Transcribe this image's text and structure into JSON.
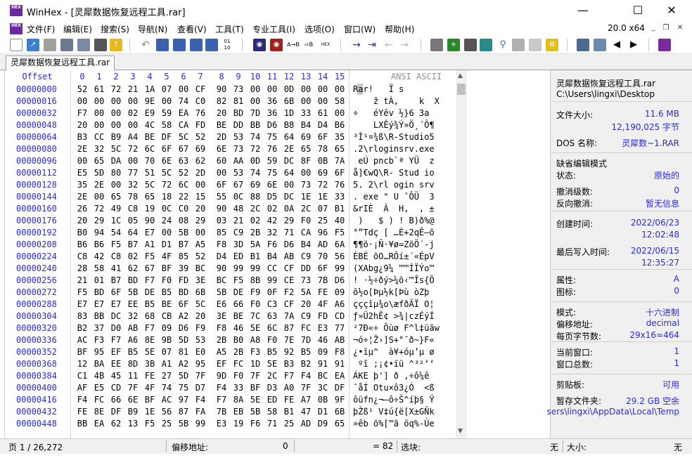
{
  "window": {
    "title": "WinHex - [灵犀数据恢复远程工具.rar]",
    "app_icon": "HEX"
  },
  "menu": [
    "文件(F)",
    "编辑(E)",
    "搜索(S)",
    "导航(N)",
    "查看(V)",
    "工具(T)",
    "专业工具(I)",
    "选项(O)",
    "窗口(W)",
    "帮助(H)"
  ],
  "version": "20.0 x64",
  "tab": "灵犀数据恢复远程工具.rar",
  "hex_header": {
    "offset": "Offset",
    "columns": [
      "0",
      "1",
      "2",
      "3",
      "4",
      "5",
      "6",
      "7",
      "8",
      "9",
      "10",
      "11",
      "12",
      "13",
      "14",
      "15"
    ],
    "ansi": "ANSI ASCII"
  },
  "rows": [
    {
      "off": "00000000",
      "hex": [
        "52",
        "61",
        "72",
        "21",
        "1A",
        "07",
        "00",
        "CF",
        "90",
        "73",
        "00",
        "00",
        "0D",
        "00",
        "00",
        "00"
      ],
      "ansi": "Rar!   Ï s"
    },
    {
      "off": "00000016",
      "hex": [
        "00",
        "00",
        "00",
        "00",
        "9E",
        "00",
        "74",
        "C0",
        "82",
        "81",
        "00",
        "36",
        "6B",
        "00",
        "00",
        "58"
      ],
      "ansi": "    ž tÀ‚    k  X"
    },
    {
      "off": "00000032",
      "hex": [
        "F7",
        "00",
        "00",
        "02",
        "E9",
        "59",
        "EA",
        "76",
        "20",
        "BD",
        "7D",
        "36",
        "1D",
        "33",
        "61",
        "00"
      ],
      "ansi": "÷   éYêv ½}6 3a"
    },
    {
      "off": "00000048",
      "hex": [
        "20",
        "00",
        "00",
        "00",
        "4C",
        "58",
        "CA",
        "FD",
        "BE",
        "DD",
        "BB",
        "D6",
        "B8",
        "B4",
        "D4",
        "B6"
      ],
      "ansi": "    LXÊý¾Ý»Ö¸´Ô¶"
    },
    {
      "off": "00000064",
      "hex": [
        "B3",
        "CC",
        "B9",
        "A4",
        "BE",
        "DF",
        "5C",
        "52",
        "2D",
        "53",
        "74",
        "75",
        "64",
        "69",
        "6F",
        "35"
      ],
      "ansi": "³Ì¹¤¾ß\\R-Studio5"
    },
    {
      "off": "00000080",
      "hex": [
        "2E",
        "32",
        "5C",
        "72",
        "6C",
        "6F",
        "67",
        "69",
        "6E",
        "73",
        "72",
        "76",
        "2E",
        "65",
        "78",
        "65"
      ],
      "ansi": ".2\\rloginsrv.exe"
    },
    {
      "off": "00000096",
      "hex": [
        "00",
        "65",
        "DA",
        "00",
        "70",
        "6E",
        "63",
        "62",
        "60",
        "AA",
        "0D",
        "59",
        "DC",
        "8F",
        "0B",
        "7A"
      ],
      "ansi": " eÚ pncb`ª YÜ  z"
    },
    {
      "off": "00000112",
      "hex": [
        "E5",
        "5D",
        "80",
        "77",
        "51",
        "5C",
        "52",
        "2D",
        "00",
        "53",
        "74",
        "75",
        "64",
        "00",
        "69",
        "6F"
      ],
      "ansi": "å]€wQ\\R- Stud io"
    },
    {
      "off": "00000128",
      "hex": [
        "35",
        "2E",
        "00",
        "32",
        "5C",
        "72",
        "6C",
        "00",
        "6F",
        "67",
        "69",
        "6E",
        "00",
        "73",
        "72",
        "76"
      ],
      "ansi": "5. 2\\rl ogin srv"
    },
    {
      "off": "00000144",
      "hex": [
        "2E",
        "00",
        "65",
        "78",
        "65",
        "18",
        "22",
        "15",
        "55",
        "0C",
        "88",
        "D5",
        "DC",
        "1E",
        "1E",
        "33"
      ],
      "ansi": ". exe \" U ˆÕÜ  3"
    },
    {
      "off": "00000160",
      "hex": [
        "26",
        "72",
        "49",
        "C8",
        "19",
        "0C",
        "C0",
        "20",
        "90",
        "48",
        "2C",
        "02",
        "0A",
        "2C",
        "07",
        "B1"
      ],
      "ansi": "&rIÈ  À  H,  , ±"
    },
    {
      "off": "00000176",
      "hex": [
        "20",
        "29",
        "1C",
        "05",
        "90",
        "24",
        "08",
        "29",
        "03",
        "21",
        "02",
        "42",
        "29",
        "F0",
        "25",
        "40"
      ],
      "ansi": " )   $ ) ! B)ð%@"
    },
    {
      "off": "00000192",
      "hex": [
        "B0",
        "94",
        "54",
        "64",
        "E7",
        "00",
        "5B",
        "00",
        "85",
        "C9",
        "2B",
        "32",
        "71",
        "CA",
        "96",
        "F5"
      ],
      "ansi": "°”Tdç [ …É+2qÊ–õ"
    },
    {
      "off": "00000208",
      "hex": [
        "B6",
        "B6",
        "F5",
        "B7",
        "A1",
        "D1",
        "B7",
        "A5",
        "F8",
        "3D",
        "5A",
        "F6",
        "D6",
        "B4",
        "AD",
        "6A"
      ],
      "ansi": "¶¶õ·¡Ñ·¥ø=ZöÖ´-j"
    },
    {
      "off": "00000224",
      "hex": [
        "C8",
        "42",
        "C8",
        "02",
        "F5",
        "4F",
        "85",
        "52",
        "D4",
        "ED",
        "B1",
        "B4",
        "AB",
        "C9",
        "70",
        "56"
      ],
      "ansi": "ÈBÈ õO…RÔí±´«ÉpV"
    },
    {
      "off": "00000240",
      "hex": [
        "28",
        "58",
        "41",
        "62",
        "67",
        "BF",
        "39",
        "BC",
        "90",
        "99",
        "99",
        "CC",
        "CF",
        "DD",
        "6F",
        "99"
      ],
      "ansi": "(XAbg¿9¼ ™™ÌÏÝo™"
    },
    {
      "off": "00000256",
      "hex": [
        "21",
        "01",
        "B7",
        "BD",
        "F7",
        "F0",
        "FD",
        "3E",
        "BC",
        "F5",
        "8B",
        "99",
        "CE",
        "73",
        "7B",
        "D6"
      ],
      "ansi": "! ·½÷ðý>¼õ‹™Îs{Ö"
    },
    {
      "off": "00000272",
      "hex": [
        "F5",
        "BD",
        "6F",
        "5B",
        "DE",
        "B5",
        "BD",
        "6B",
        "5B",
        "DE",
        "F9",
        "0F",
        "F2",
        "5A",
        "FE",
        "09"
      ],
      "ansi": "õ½o[Þµ½k[Þù òZþ"
    },
    {
      "off": "00000288",
      "hex": [
        "E7",
        "E7",
        "E7",
        "EE",
        "B5",
        "BE",
        "6F",
        "5C",
        "E6",
        "66",
        "F0",
        "C3",
        "CF",
        "20",
        "4F",
        "A6"
      ],
      "ansi": "çççîµ¾o\\æfðÃÏ O¦"
    },
    {
      "off": "00000304",
      "hex": [
        "83",
        "BB",
        "DC",
        "32",
        "68",
        "CB",
        "A2",
        "20",
        "3E",
        "BE",
        "7C",
        "63",
        "7A",
        "C9",
        "FD",
        "CD"
      ],
      "ansi": "ƒ»Ü2hË¢ >¾|czÉýÍ"
    },
    {
      "off": "00000320",
      "hex": [
        "B2",
        "37",
        "D0",
        "AB",
        "F7",
        "09",
        "D6",
        "F9",
        "F8",
        "46",
        "5E",
        "6C",
        "87",
        "FC",
        "E3",
        "77"
      ],
      "ansi": "²7Ð«÷ Öùø F^l‡üãw"
    },
    {
      "off": "00000336",
      "hex": [
        "AC",
        "F3",
        "F7",
        "A6",
        "8E",
        "9B",
        "5D",
        "53",
        "2B",
        "B0",
        "A8",
        "F0",
        "7E",
        "7D",
        "46",
        "AB"
      ],
      "ansi": "¬ó÷¦Ž›]S+°¨ð~}F«"
    },
    {
      "off": "00000352",
      "hex": [
        "BF",
        "95",
        "EF",
        "B5",
        "5E",
        "07",
        "81",
        "E0",
        "A5",
        "2B",
        "F3",
        "B5",
        "92",
        "B5",
        "09",
        "F8"
      ],
      "ansi": "¿•ïµ^  à¥+óµ’µ ø"
    },
    {
      "off": "00000368",
      "hex": [
        "12",
        "BA",
        "EE",
        "8D",
        "3B",
        "A1",
        "A2",
        "95",
        "EF",
        "FC",
        "1D",
        "5E",
        "B3",
        "B2",
        "91",
        "91"
      ],
      "ansi": " ºî ;¡¢•ïü ^³²‘‘"
    },
    {
      "off": "00000384",
      "hex": [
        "C1",
        "4B",
        "45",
        "11",
        "FE",
        "27",
        "5D",
        "7F",
        "9D",
        "F0",
        "7F",
        "2C",
        "F7",
        "F4",
        "BC",
        "EA"
      ],
      "ansi": "ÁKE þ'] ð ,÷ô¼ê"
    },
    {
      "off": "00000400",
      "hex": [
        "AF",
        "E5",
        "CD",
        "7F",
        "4F",
        "74",
        "75",
        "D7",
        "F4",
        "33",
        "BF",
        "D3",
        "A0",
        "7F",
        "3C",
        "DF"
      ],
      "ansi": "¯åÍ Otu×ô3¿Ó  <ß"
    },
    {
      "off": "00000416",
      "hex": [
        "F4",
        "FC",
        "66",
        "6E",
        "BF",
        "AC",
        "97",
        "F4",
        "F7",
        "8A",
        "5E",
        "ED",
        "FE",
        "A7",
        "0B",
        "9F"
      ],
      "ansi": "ôüfn¿¬—ô÷Š^íþ§ Ÿ"
    },
    {
      "off": "00000432",
      "hex": [
        "FE",
        "8E",
        "DF",
        "B9",
        "1E",
        "56",
        "87",
        "FA",
        "7B",
        "EB",
        "5B",
        "58",
        "B1",
        "47",
        "D1",
        "6B"
      ],
      "ansi": "þŽß¹ V‡ú{ë[X±GÑk"
    },
    {
      "off": "00000448",
      "hex": [
        "BB",
        "EA",
        "62",
        "13",
        "F5",
        "25",
        "5B",
        "99",
        "E3",
        "19",
        "F6",
        "71",
        "25",
        "AD",
        "D9",
        "65"
      ],
      "ansi": "»êb õ%[™ã öq%-Ùe"
    }
  ],
  "info": [
    {
      "label": "灵犀数据恢复远程工具.rar",
      "value": ""
    },
    {
      "label": "C:\\Users\\lingxi\\Desktop",
      "value": ""
    },
    {
      "label": "文件大小:",
      "value": "11.6 MB"
    },
    {
      "label": "",
      "value": "12,190,025 字节"
    },
    {
      "label": "DOS 名称:",
      "value": "灵犀数~1.RAR"
    },
    {
      "label": "缺省编辑模式",
      "value": ""
    },
    {
      "label": "状态:",
      "value": "原始的"
    },
    {
      "label": "撤消级数:",
      "value": "0"
    },
    {
      "label": "反向撤消:",
      "value": "暂无信息"
    },
    {
      "label": "创建时间:",
      "value": "2022/06/23"
    },
    {
      "label": "",
      "value": "12:02:48"
    },
    {
      "label": "最后写入时间:",
      "value": "2022/06/15"
    },
    {
      "label": "",
      "value": "12:35:27"
    },
    {
      "label": "属性:",
      "value": "A"
    },
    {
      "label": "图标:",
      "value": "0"
    },
    {
      "label": "模式:",
      "value": "十六进制"
    },
    {
      "label": "偏移地址:",
      "value": "decimal"
    },
    {
      "label": "每页字节数:",
      "value": "29x16=464"
    },
    {
      "label": "当前窗口:",
      "value": "1"
    },
    {
      "label": "窗口总数:",
      "value": "1"
    },
    {
      "label": "剪贴板:",
      "value": "可用"
    },
    {
      "label": "暂存文件夹:",
      "value": "29.2 GB 空余"
    },
    {
      "label": "",
      "value": "sers\\lingxi\\AppData\\Local\\Temp"
    }
  ],
  "status": {
    "page": "页 1 / 26,272",
    "offset_label": "偏移地址:",
    "offset_value": "0",
    "eq_value": "= 82",
    "sel_label": "选块:",
    "sel_value": "无",
    "size_label": "大小:",
    "size_value": "无"
  },
  "colors": {
    "accent": "#2a2ad8",
    "hex_text": "#000000",
    "panel": "#f0f0f0"
  }
}
